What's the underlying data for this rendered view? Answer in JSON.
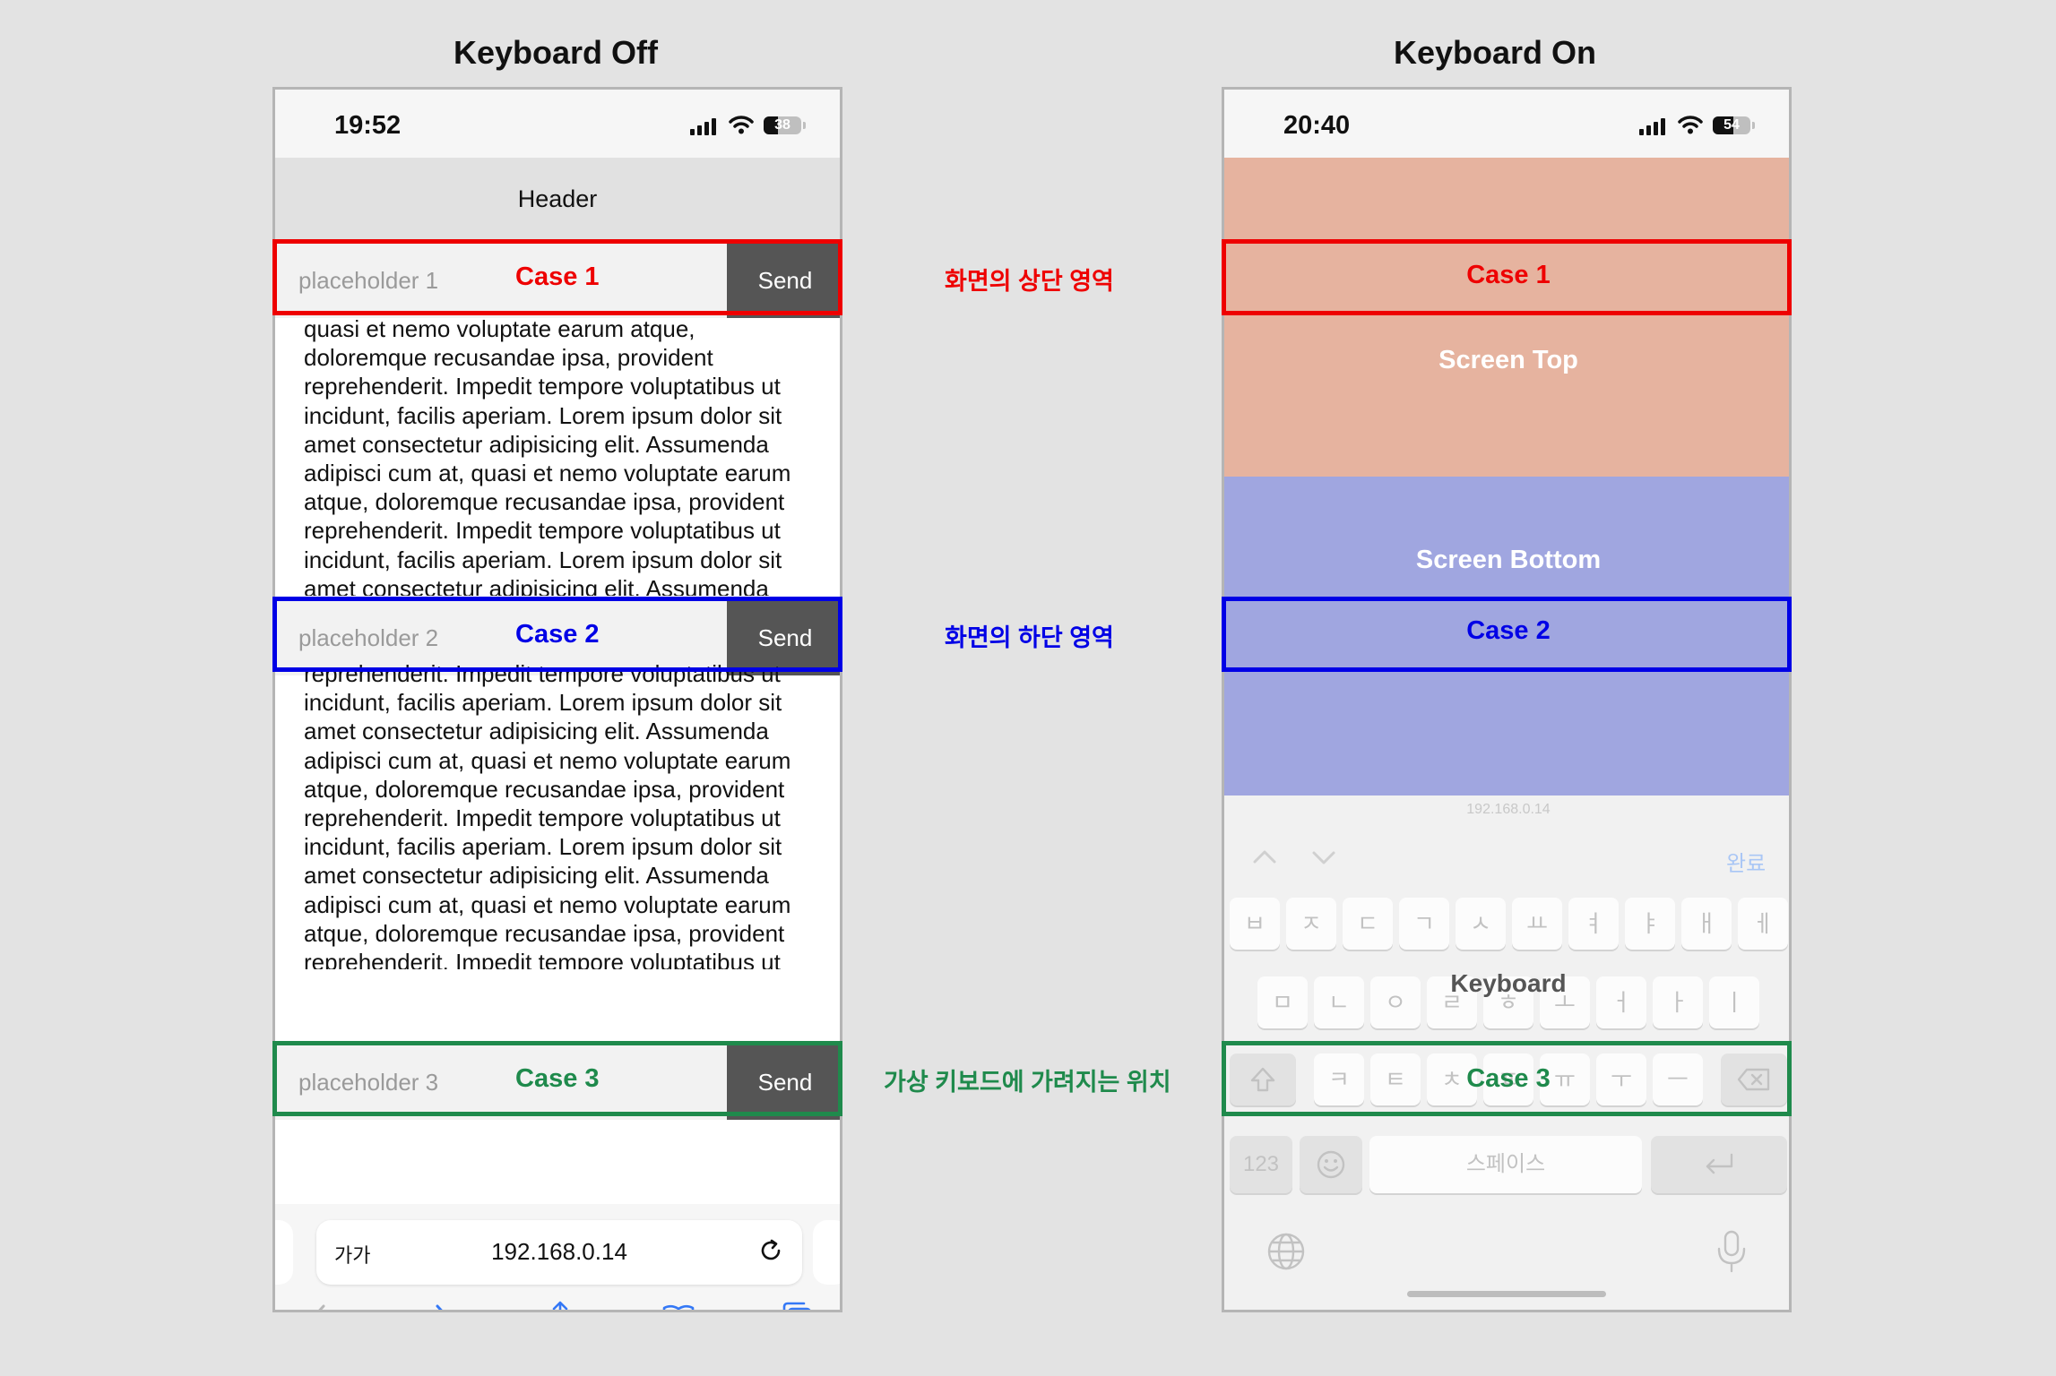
{
  "titles": {
    "left": "Keyboard Off",
    "right": "Keyboard On"
  },
  "colors": {
    "case1": "#ee0000",
    "case2": "#0000e6",
    "case3": "#1f8a4c",
    "top_zone": "#e6b39f",
    "bottom_zone": "#a0a6e0",
    "link_blue": "#3478f6"
  },
  "left_phone": {
    "status": {
      "time": "19:52",
      "battery": "38"
    },
    "header": "Header",
    "inputs": [
      {
        "placeholder": "placeholder 1",
        "case": "Case 1",
        "send": "Send"
      },
      {
        "placeholder": "placeholder 2",
        "case": "Case 2",
        "send": "Send"
      },
      {
        "placeholder": "placeholder 3",
        "case": "Case 3",
        "send": "Send"
      }
    ],
    "para1": "quasi et nemo voluptate earum atque, doloremque recusandae ipsa, provident reprehenderit. Impedit tempore voluptatibus ut incidunt, facilis aperiam. Lorem ipsum dolor sit amet consectetur adipisicing elit. Assumenda adipisci cum at, quasi et nemo voluptate earum atque, doloremque recusandae ipsa, provident reprehenderit. Impedit tempore voluptatibus ut incidunt, facilis aperiam. Lorem ipsum dolor sit amet consectetur adipisicing elit. Assumenda",
    "para2": "reprehenderit. Impedit tempore voluptatibus ut incidunt, facilis aperiam. Lorem ipsum dolor sit amet consectetur adipisicing elit. Assumenda adipisci cum at, quasi et nemo voluptate earum atque, doloremque recusandae ipsa, provident reprehenderit. Impedit tempore voluptatibus ut incidunt, facilis aperiam. Lorem ipsum dolor sit amet consectetur adipisicing elit. Assumenda adipisci cum at, quasi et nemo voluptate earum atque, doloremque recusandae ipsa, provident reprehenderit. Impedit tempore voluptatibus ut incidunt, facilis aperiam.",
    "browser": {
      "aa": "가가",
      "url": "192.168.0.14"
    },
    "icons": [
      "back-icon",
      "forward-icon",
      "share-icon",
      "bookmarks-icon",
      "tabs-icon",
      "reload-icon"
    ]
  },
  "annotations": {
    "top": "화면의 상단 영역",
    "bottom": "화면의 하단 영역",
    "hidden": "가상 키보드에 가려지는 위치"
  },
  "right_phone": {
    "status": {
      "time": "20:40",
      "battery": "54"
    },
    "case1": "Case 1",
    "screen_top": "Screen Top",
    "screen_bottom": "Screen Bottom",
    "case2": "Case 2",
    "url_hint": "192.168.0.14",
    "done": "완료",
    "keyboard_label": "Keyboard",
    "case3": "Case 3",
    "keys_row1": [
      "ㅂ",
      "ㅈ",
      "ㄷ",
      "ㄱ",
      "ㅅ",
      "ㅛ",
      "ㅕ",
      "ㅑ",
      "ㅐ",
      "ㅔ"
    ],
    "keys_row2": [
      "ㅁ",
      "ㄴ",
      "ㅇ",
      "ㄹ",
      "ㅎ",
      "ㅗ",
      "ㅓ",
      "ㅏ",
      "ㅣ"
    ],
    "keys_row3": [
      "ㅋ",
      "ㅌ",
      "ㅊ",
      "ㅍ",
      "ㅠ",
      "ㅜ",
      "ㅡ"
    ],
    "key_123": "123",
    "key_space": "스페이스",
    "icons": [
      "chevron-up-icon",
      "chevron-down-icon",
      "shift-icon",
      "backspace-icon",
      "emoji-icon",
      "return-icon",
      "globe-icon",
      "microphone-icon"
    ]
  }
}
